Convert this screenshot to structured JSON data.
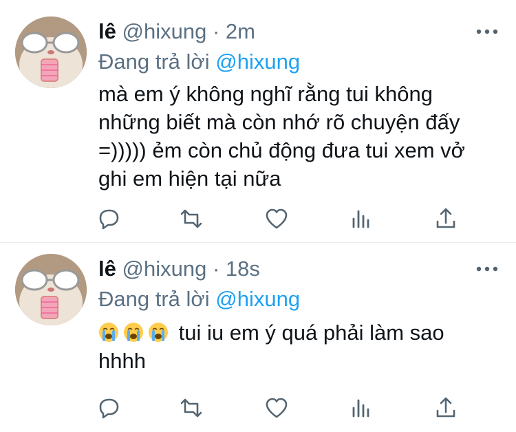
{
  "tweets": [
    {
      "display_name": "lê",
      "handle": "@hixung",
      "separator": "·",
      "time": "2m",
      "reply_prefix": "Đang trả lời",
      "reply_to": "@hixung",
      "emojis": [],
      "text": "mà em ý không nghĩ rằng tui không những biết mà còn nhớ rõ chuyện đấy =))))) ẻm còn chủ động đưa tui xem vở ghi em hiện tại nữa",
      "icons": [
        "reply-icon",
        "retweet-icon",
        "like-icon",
        "analytics-icon",
        "share-icon",
        "more-icon"
      ]
    },
    {
      "display_name": "lê",
      "handle": "@hixung",
      "separator": "·",
      "time": "18s",
      "reply_prefix": "Đang trả lời",
      "reply_to": "@hixung",
      "emojis": [
        "loudly-crying-face-emoji",
        "loudly-crying-face-emoji",
        "loudly-crying-face-emoji"
      ],
      "text": "tui iu em ý quá phải làm sao hhhh",
      "icons": [
        "reply-icon",
        "retweet-icon",
        "like-icon",
        "analytics-icon",
        "share-icon",
        "more-icon"
      ]
    }
  ],
  "colors": {
    "text": "#0f1419",
    "secondary": "#5b7083",
    "link": "#1da1f2",
    "icon": "#536471",
    "divider": "#e6ecf0"
  }
}
